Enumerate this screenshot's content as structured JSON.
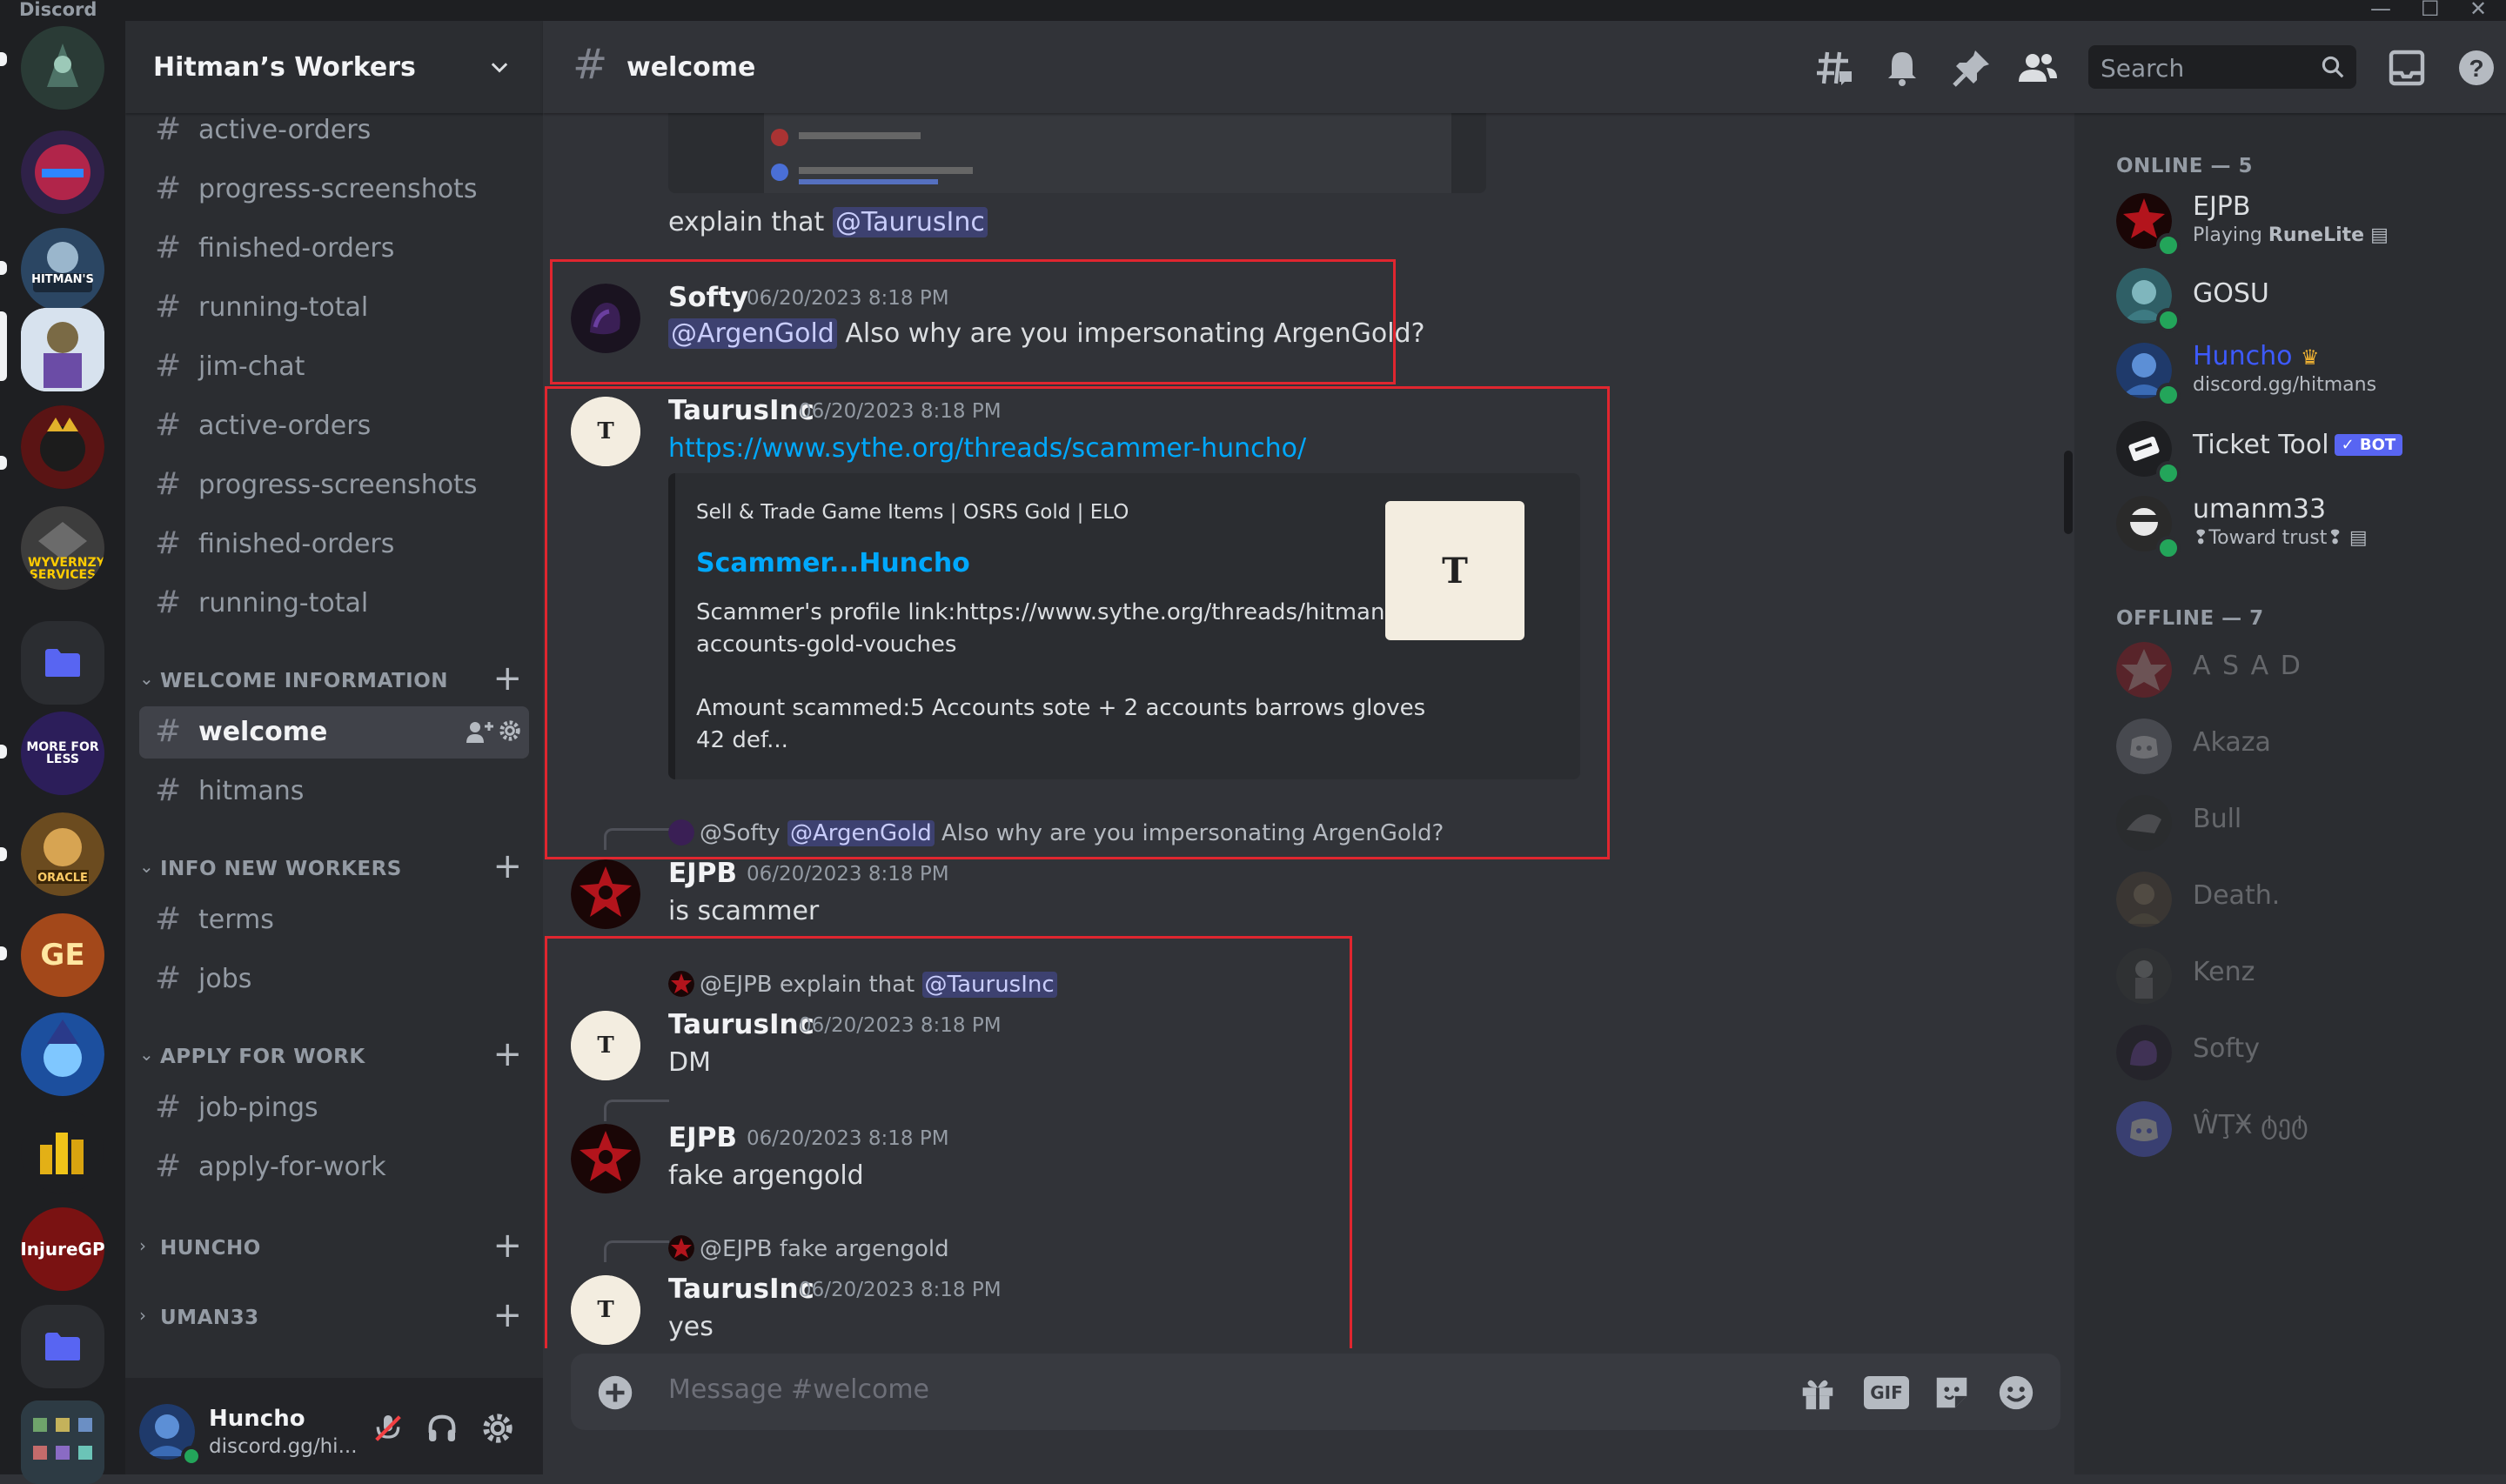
{
  "app": {
    "name": "Discord",
    "window_controls": [
      "—",
      "☐",
      "✕"
    ]
  },
  "server": {
    "name": "Hitman’s Workers"
  },
  "server_rail": [
    {
      "name": "Hitman's Accounts & Gold",
      "label": "HITMAN'S"
    },
    {
      "name": "Wyvernzy Services",
      "label": "WYVERNZY SERVICES"
    },
    {
      "name": "More For Less",
      "label": "MORE FOR LESS"
    },
    {
      "name": "Oracle",
      "label": "ORACLE"
    },
    {
      "name": "GE",
      "label": "GE"
    },
    {
      "name": "InjureGP",
      "label": "InjureGP"
    }
  ],
  "channels": {
    "top": [
      "active-orders",
      "progress-screenshots",
      "finished-orders",
      "running-total",
      "jim-chat",
      "active-orders",
      "progress-screenshots",
      "finished-orders",
      "running-total"
    ],
    "categories": [
      {
        "name": "WELCOME INFORMATION",
        "channels": [
          "welcome",
          "hitmans"
        ]
      },
      {
        "name": "INFO NEW WORKERS",
        "channels": [
          "terms",
          "jobs"
        ]
      },
      {
        "name": "APPLY FOR WORK",
        "channels": [
          "job-pings",
          "apply-for-work"
        ]
      },
      {
        "name": "HUNCHO",
        "channels": []
      },
      {
        "name": "UMAN33",
        "channels": []
      }
    ]
  },
  "user_panel": {
    "username": "Huncho",
    "status": "discord.gg/hi..."
  },
  "chat": {
    "channel": "welcome",
    "search_placeholder": "Search",
    "composer_placeholder": "Message #welcome",
    "composer_gif": "GIF",
    "top_message_text": "explain that",
    "top_message_mention": "@TaurusInc",
    "messages": [
      {
        "author": "Softy",
        "timestamp": "06/20/2023 8:18 PM",
        "mention": "@ArgenGold",
        "text": "Also why are you impersonating ArgenGold?"
      },
      {
        "author": "TaurusInc",
        "timestamp": "06/20/2023 8:18 PM",
        "link": "https://www.sythe.org/threads/scammer-huncho/",
        "embed": {
          "provider": "Sell & Trade Game Items | OSRS Gold | ELO",
          "title": "Scammer...Huncho",
          "desc_line1": "Scammer's profile link:https://www.sythe.org/threads/hitmans-",
          "desc_line2": "accounts-gold-vouches",
          "desc_line3": "Amount scammed:5 Accounts sote + 2 accounts barrows gloves",
          "desc_line4": "42 def..."
        }
      },
      {
        "reply_author": "@Softy",
        "reply_mention": "@ArgenGold",
        "reply_text": "Also why are you impersonating ArgenGold?"
      },
      {
        "author": "EJPB",
        "timestamp": "06/20/2023 8:18 PM",
        "text": "is scammer"
      },
      {
        "reply_author": "@EJPB",
        "reply_text": "explain that",
        "reply_mention": "@TaurusInc",
        "author": "TaurusInc",
        "timestamp": "06/20/2023 8:18 PM",
        "text": "DM"
      },
      {
        "author": "EJPB",
        "timestamp": "06/20/2023 8:18 PM",
        "text": "fake argengold"
      },
      {
        "reply_author": "@EJPB",
        "reply_text": "fake argengold",
        "author": "TaurusInc",
        "timestamp": "06/20/2023 8:18 PM",
        "text": "yes"
      }
    ]
  },
  "members": {
    "online_header": "ONLINE — 5",
    "offline_header": "OFFLINE — 7",
    "online": [
      {
        "name": "EJPB",
        "activity_prefix": "Playing",
        "activity": "RuneLite"
      },
      {
        "name": "GOSU",
        "activity": ""
      },
      {
        "name": "Huncho",
        "activity": "discord.gg/hitmans",
        "name_color": "#3d5afe"
      },
      {
        "name": "Ticket Tool",
        "badge": "✓ BOT"
      },
      {
        "name": "umanm33",
        "activity": "❢Toward trust❢"
      }
    ],
    "offline": [
      "A S A D",
      "Akaza",
      "Bull",
      "Death.",
      "Kenz",
      "Softy",
      "ŴŢӾ ტეტ"
    ]
  },
  "colors": {
    "accent": "#5865f2",
    "link": "#00a8fc",
    "online": "#23a55a",
    "highlight_box": "#e0262f"
  }
}
